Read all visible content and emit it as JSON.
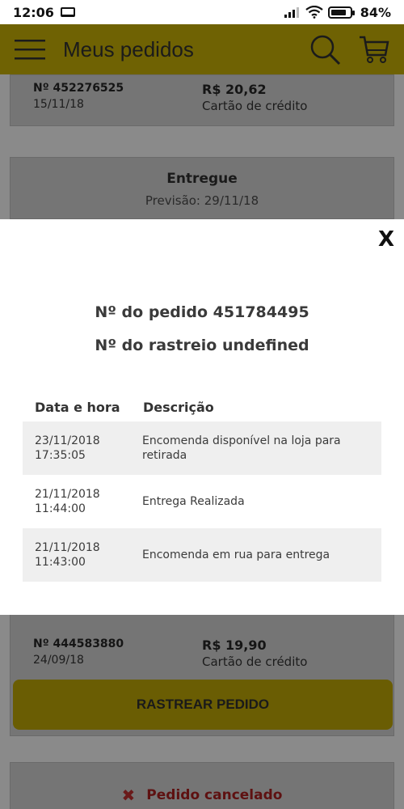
{
  "status_bar": {
    "time": "12:06",
    "battery": "84%"
  },
  "appbar": {
    "title": "Meus pedidos"
  },
  "order_top": {
    "number": "Nº 452276525",
    "date": "15/11/18",
    "price": "R$ 20,62",
    "payment": "Cartão de crédito"
  },
  "status_card": {
    "status": "Entregue",
    "eta": "Previsão: 29/11/18"
  },
  "modal": {
    "close_label": "X",
    "order_number": "Nº do pedido 451784495",
    "tracking_number": "Nº do rastreio undefined",
    "columns": [
      "Data e hora",
      "Descrição"
    ],
    "rows": [
      {
        "date": "23/11/2018",
        "time": "17:35:05",
        "description": "Encomenda disponível na loja para retirada"
      },
      {
        "date": "21/11/2018",
        "time": "11:44:00",
        "description": "Entrega Realizada"
      },
      {
        "date": "21/11/2018",
        "time": "11:43:00",
        "description": "Encomenda em rua para entrega"
      }
    ]
  },
  "order_bottom": {
    "number": "Nº 444583880",
    "date": "24/09/18",
    "price": "R$ 19,90",
    "payment": "Cartão de crédito"
  },
  "track_button": "RASTREAR PEDIDO",
  "cancel_card": {
    "status": "Pedido cancelado"
  }
}
